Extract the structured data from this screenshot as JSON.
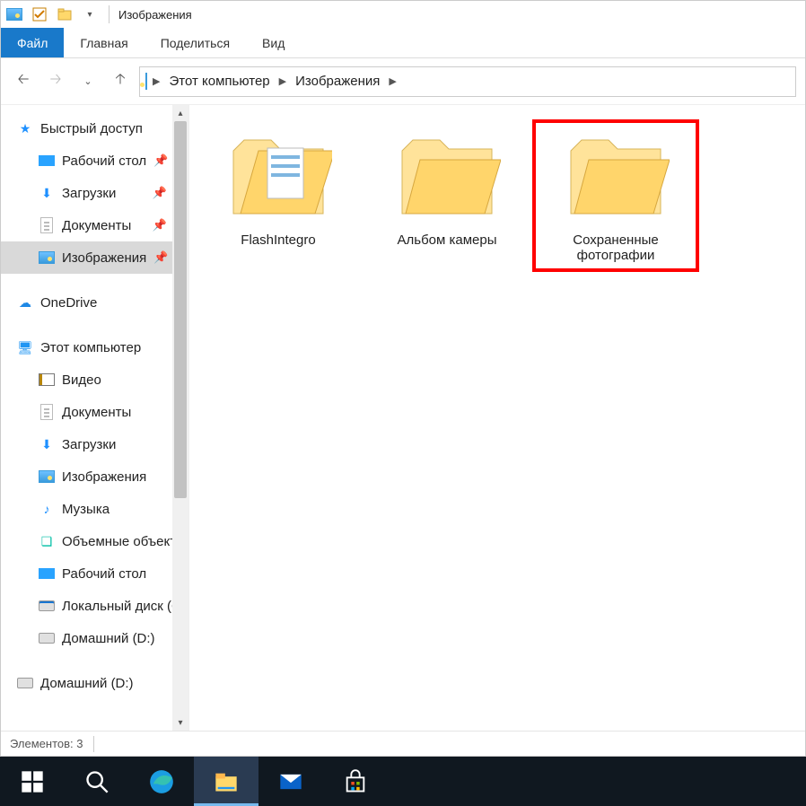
{
  "titlebar": {
    "title": "Изображения"
  },
  "ribbon": {
    "file": "Файл",
    "tabs": [
      "Главная",
      "Поделиться",
      "Вид"
    ]
  },
  "breadcrumb": {
    "items": [
      "Этот компьютер",
      "Изображения"
    ]
  },
  "sidebar": {
    "quick_access": "Быстрый доступ",
    "quick_items": [
      {
        "label": "Рабочий стол",
        "pinned": true
      },
      {
        "label": "Загрузки",
        "pinned": true
      },
      {
        "label": "Документы",
        "pinned": true
      },
      {
        "label": "Изображения",
        "pinned": true,
        "selected": true
      }
    ],
    "onedrive": "OneDrive",
    "this_pc": "Этот компьютер",
    "pc_items": [
      "Видео",
      "Документы",
      "Загрузки",
      "Изображения",
      "Музыка",
      "Объемные объекты",
      "Рабочий стол",
      "Локальный диск (C:)",
      "Домашний (D:)"
    ],
    "extra_drive": "Домашний (D:)"
  },
  "folders": [
    {
      "label": "FlashIntegro",
      "has_content": true
    },
    {
      "label": "Альбом камеры",
      "has_content": false
    },
    {
      "label": "Сохраненные фотографии",
      "has_content": false,
      "highlight": true
    }
  ],
  "status": {
    "text": "Элементов: 3"
  },
  "taskbar": {
    "items": [
      "start",
      "search",
      "edge",
      "explorer",
      "mail",
      "store"
    ]
  }
}
